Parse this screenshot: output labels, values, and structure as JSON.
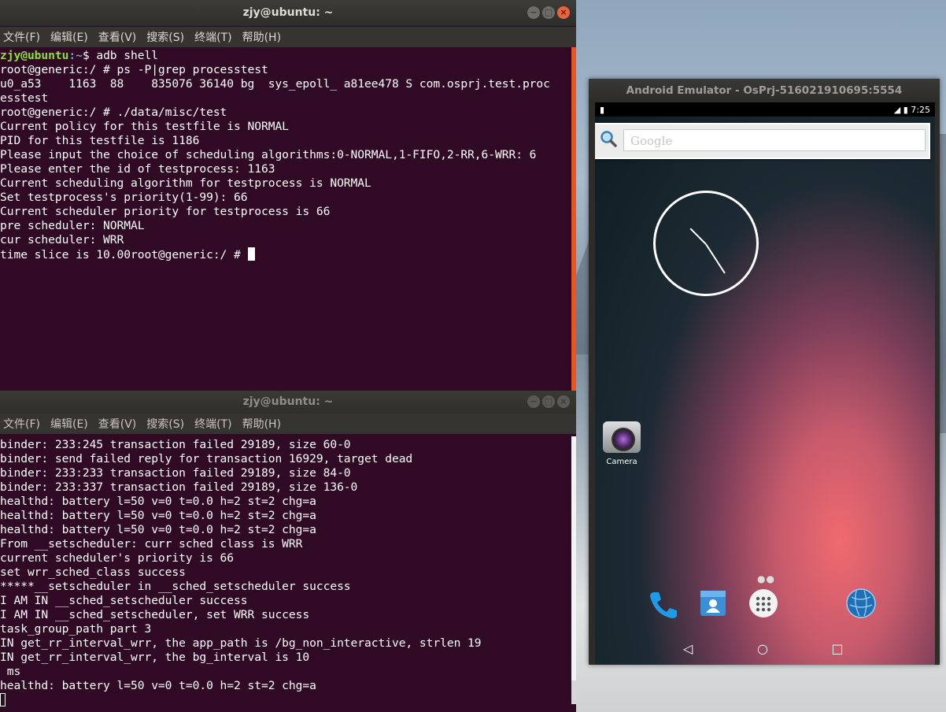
{
  "terminal_top": {
    "title": "zjy@ubuntu: ~",
    "menu": [
      "文件(F)",
      "编辑(E)",
      "查看(V)",
      "搜索(S)",
      "终端(T)",
      "帮助(H)"
    ],
    "prompt_user": "zjy@ubuntu",
    "prompt_path": ":~",
    "prompt_cmd": "$ adb shell",
    "lines": [
      "root@generic:/ # ps -P|grep processtest",
      "u0_a53    1163  88    835076 36140 bg  sys_epoll_ a81ee478 S com.osprj.test.proc",
      "esstest",
      "root@generic:/ # ./data/misc/test",
      "Current policy for this testfile is NORMAL",
      "PID for this testfile is 1186",
      "Please input the choice of scheduling algorithms:0-NORMAL,1-FIFO,2-RR,6-WRR: 6",
      "Please enter the id of testprocess: 1163",
      "Current scheduling algorithm for testprocess is NORMAL",
      "Set testprocess's priority(1-99): 66",
      "Current scheduler priority for testprocess is 66",
      "pre scheduler: NORMAL",
      "cur scheduler: WRR"
    ],
    "last_line": "time slice is 10.00root@generic:/ # "
  },
  "terminal_bottom": {
    "title": "zjy@ubuntu: ~",
    "menu": [
      "文件(F)",
      "编辑(E)",
      "查看(V)",
      "搜索(S)",
      "终端(T)",
      "帮助(H)"
    ],
    "lines": [
      "binder: 233:245 transaction failed 29189, size 60-0",
      "binder: send failed reply for transaction 16929, target dead",
      "binder: 233:233 transaction failed 29189, size 84-0",
      "binder: 233:337 transaction failed 29189, size 136-0",
      "healthd: battery l=50 v=0 t=0.0 h=2 st=2 chg=a",
      "healthd: battery l=50 v=0 t=0.0 h=2 st=2 chg=a",
      "healthd: battery l=50 v=0 t=0.0 h=2 st=2 chg=a",
      "From __setscheduler: curr sched class is WRR",
      "current scheduler's priority is 66",
      "set wrr_sched_class success",
      "*****__setscheduler in __sched_setscheduler success",
      "I AM IN __sched_setscheduler success",
      "I AM IN __sched_setscheduler, set WRR success",
      "task_group_path part 3",
      "IN get_rr_interval_wrr, the app_path is /bg_non_interactive, strlen 19",
      "IN get_rr_interval_wrr, the bg_interval is 10",
      " ms",
      "healthd: battery l=50 v=0 t=0.0 h=2 st=2 chg=a"
    ]
  },
  "emulator": {
    "title": "Android Emulator - OsPrj-516021910695:5554",
    "time": "7:25",
    "search_placeholder": "Google",
    "camera_label": "Camera",
    "colors": {
      "phone": "#1e9be8",
      "contacts": "#3a8fd6"
    }
  }
}
